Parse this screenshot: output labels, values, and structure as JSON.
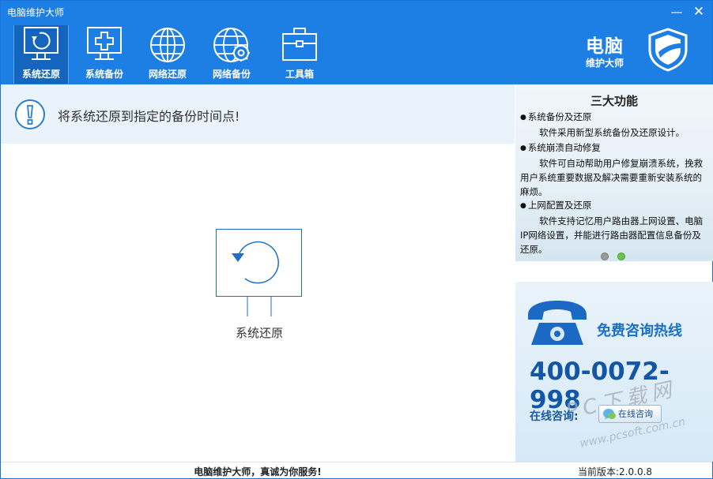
{
  "window": {
    "title": "电脑维护大师"
  },
  "window_controls": {
    "minimize": "—",
    "close": "✕"
  },
  "toolbar": {
    "items": [
      {
        "label": "系统还原",
        "icon": "system-restore-icon",
        "active": true
      },
      {
        "label": "系统备份",
        "icon": "system-backup-icon",
        "active": false
      },
      {
        "label": "网络还原",
        "icon": "network-restore-icon",
        "active": false
      },
      {
        "label": "网络备份",
        "icon": "network-backup-icon",
        "active": false
      },
      {
        "label": "工具箱",
        "icon": "toolbox-icon",
        "active": false
      }
    ]
  },
  "logo": {
    "line1": "电脑",
    "line2": "维护大师",
    "icon": "shield-icon"
  },
  "notice": {
    "icon": "exclamation-icon",
    "text": "将系统还原到指定的备份时间点!"
  },
  "center": {
    "icon": "system-restore-icon",
    "label": "系统还原"
  },
  "features": {
    "title": "三大功能",
    "items": [
      {
        "title": "系统备份及还原",
        "desc": "软件采用新型系统备份及还原设计。"
      },
      {
        "title": "系统崩溃自动修复",
        "desc": "软件可自动帮助用户修复崩溃系统，挽救用户系统重要数据及解决需要重新安装系统的麻烦。"
      },
      {
        "title": "上网配置及还原",
        "desc": "软件支持记忆用户路由器上网设置、电脑IP网络设置，并能进行路由器配置信息备份及还原。"
      }
    ],
    "carousel": {
      "pages": 2,
      "active": 2
    }
  },
  "hotline": {
    "icon": "telephone-icon",
    "title": "免费咨询热线",
    "number": "400-0072-998",
    "consult_label": "在线咨询:",
    "consult_button": "在线咨询",
    "consult_icon": "chat-icon"
  },
  "watermark": {
    "line1": "PC下载网",
    "line2": "www.pcsoft.com.cn"
  },
  "status": {
    "slogan": "电脑维护大师，真诚为你服务!",
    "version": "当前版本:2.0.0.8"
  },
  "colors": {
    "header": "#1d7ee3",
    "active_tab": "#1465bd",
    "notice_bg": "#eaf3fb",
    "hotline_text": "#1256a8"
  }
}
